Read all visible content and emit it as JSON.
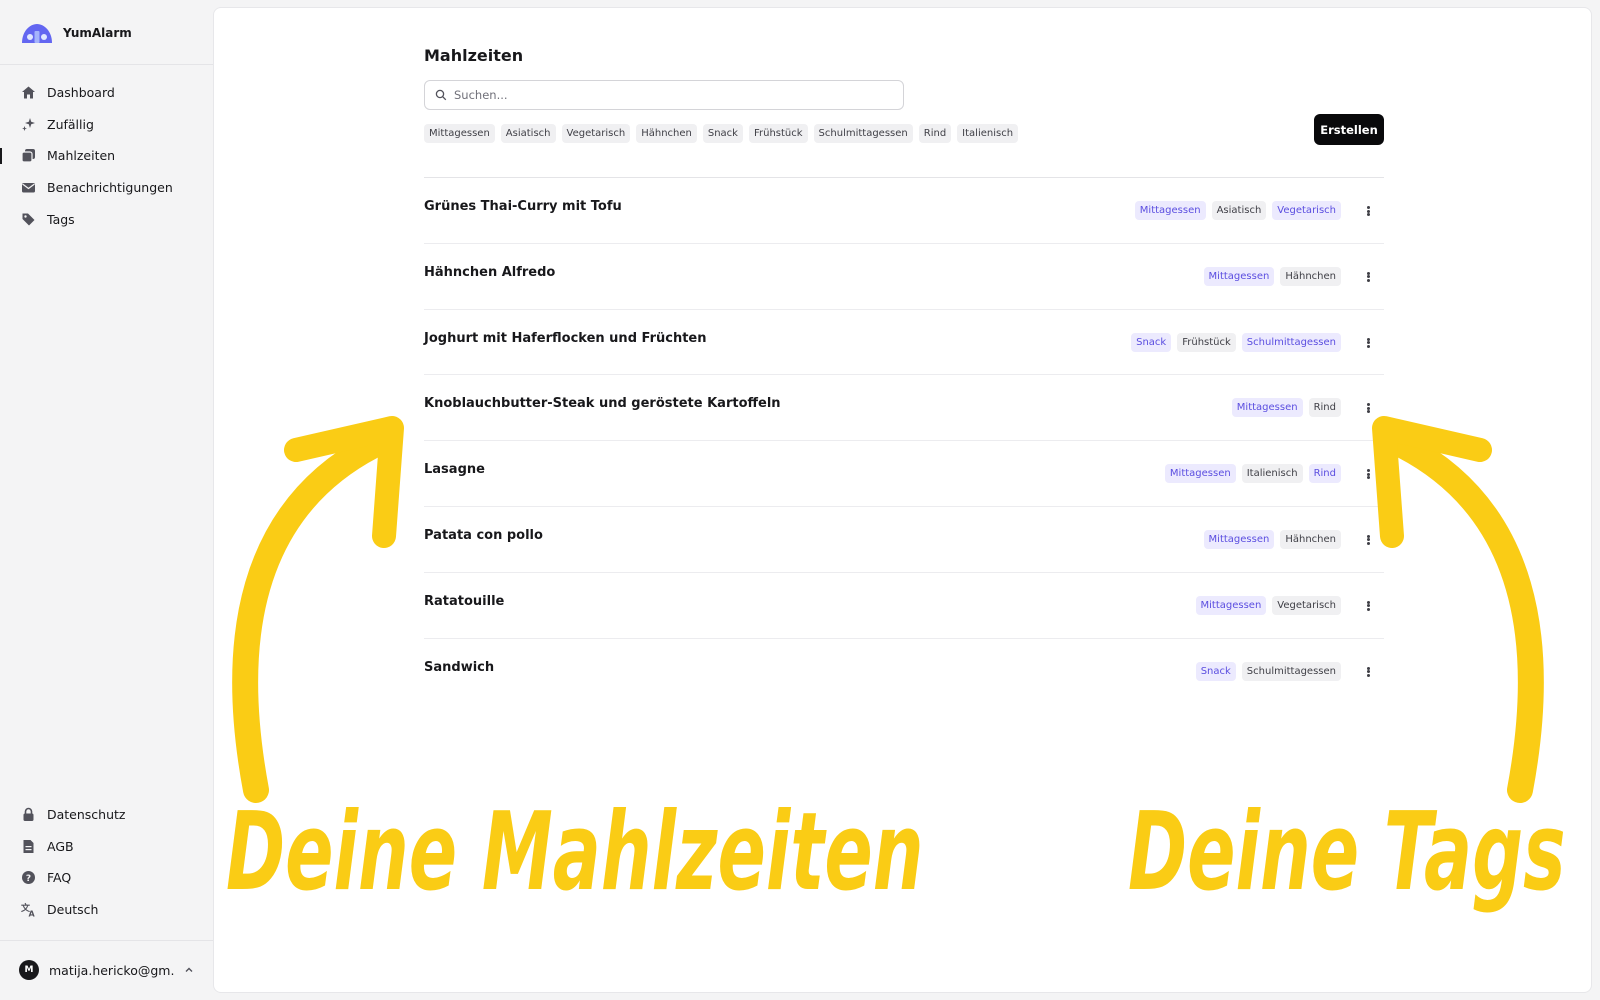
{
  "app": {
    "name": "YumAlarm",
    "brand_color": "#6366f1"
  },
  "sidebar": {
    "nav": [
      {
        "label": "Dashboard",
        "icon": "home-icon"
      },
      {
        "label": "Zufällig",
        "icon": "sparkles-icon"
      },
      {
        "label": "Mahlzeiten",
        "icon": "copy-icon",
        "active": true
      },
      {
        "label": "Benachrichtigungen",
        "icon": "mail-icon"
      },
      {
        "label": "Tags",
        "icon": "tag-icon"
      }
    ],
    "footer_nav": [
      {
        "label": "Datenschutz",
        "icon": "lock-icon"
      },
      {
        "label": "AGB",
        "icon": "document-icon"
      },
      {
        "label": "FAQ",
        "icon": "help-icon"
      },
      {
        "label": "Deutsch",
        "icon": "translate-icon"
      }
    ],
    "user": {
      "initial": "M",
      "email": "matija.hericko@gm..."
    }
  },
  "main": {
    "title": "Mahlzeiten",
    "search_placeholder": "Suchen...",
    "create_label": "Erstellen",
    "filter_tags": [
      "Mittagessen",
      "Asiatisch",
      "Vegetarisch",
      "Hähnchen",
      "Snack",
      "Frühstück",
      "Schulmittagessen",
      "Rind",
      "Italienisch"
    ],
    "meals": [
      {
        "name": "Grünes Thai-Curry mit Tofu",
        "tags": [
          {
            "label": "Mittagessen",
            "accent": true
          },
          {
            "label": "Asiatisch",
            "accent": false
          },
          {
            "label": "Vegetarisch",
            "accent": true
          }
        ]
      },
      {
        "name": "Hähnchen Alfredo",
        "tags": [
          {
            "label": "Mittagessen",
            "accent": true
          },
          {
            "label": "Hähnchen",
            "accent": false
          }
        ]
      },
      {
        "name": "Joghurt mit Haferflocken und Früchten",
        "tags": [
          {
            "label": "Snack",
            "accent": true
          },
          {
            "label": "Frühstück",
            "accent": false
          },
          {
            "label": "Schulmittagessen",
            "accent": true
          }
        ]
      },
      {
        "name": "Knoblauchbutter-Steak und geröstete Kartoffeln",
        "tags": [
          {
            "label": "Mittagessen",
            "accent": true
          },
          {
            "label": "Rind",
            "accent": false
          }
        ]
      },
      {
        "name": "Lasagne",
        "tags": [
          {
            "label": "Mittagessen",
            "accent": true
          },
          {
            "label": "Italienisch",
            "accent": false
          },
          {
            "label": "Rind",
            "accent": true
          }
        ]
      },
      {
        "name": "Patata con pollo",
        "tags": [
          {
            "label": "Mittagessen",
            "accent": true
          },
          {
            "label": "Hähnchen",
            "accent": false
          }
        ]
      },
      {
        "name": "Ratatouille",
        "tags": [
          {
            "label": "Mittagessen",
            "accent": true
          },
          {
            "label": "Vegetarisch",
            "accent": false
          }
        ]
      },
      {
        "name": "Sandwich",
        "tags": [
          {
            "label": "Snack",
            "accent": true
          },
          {
            "label": "Schulmittagessen",
            "accent": false
          }
        ]
      }
    ]
  },
  "annotations": {
    "left_label": "Deine Mahlzeiten",
    "right_label": "Deine Tags",
    "color": "#facc15"
  }
}
